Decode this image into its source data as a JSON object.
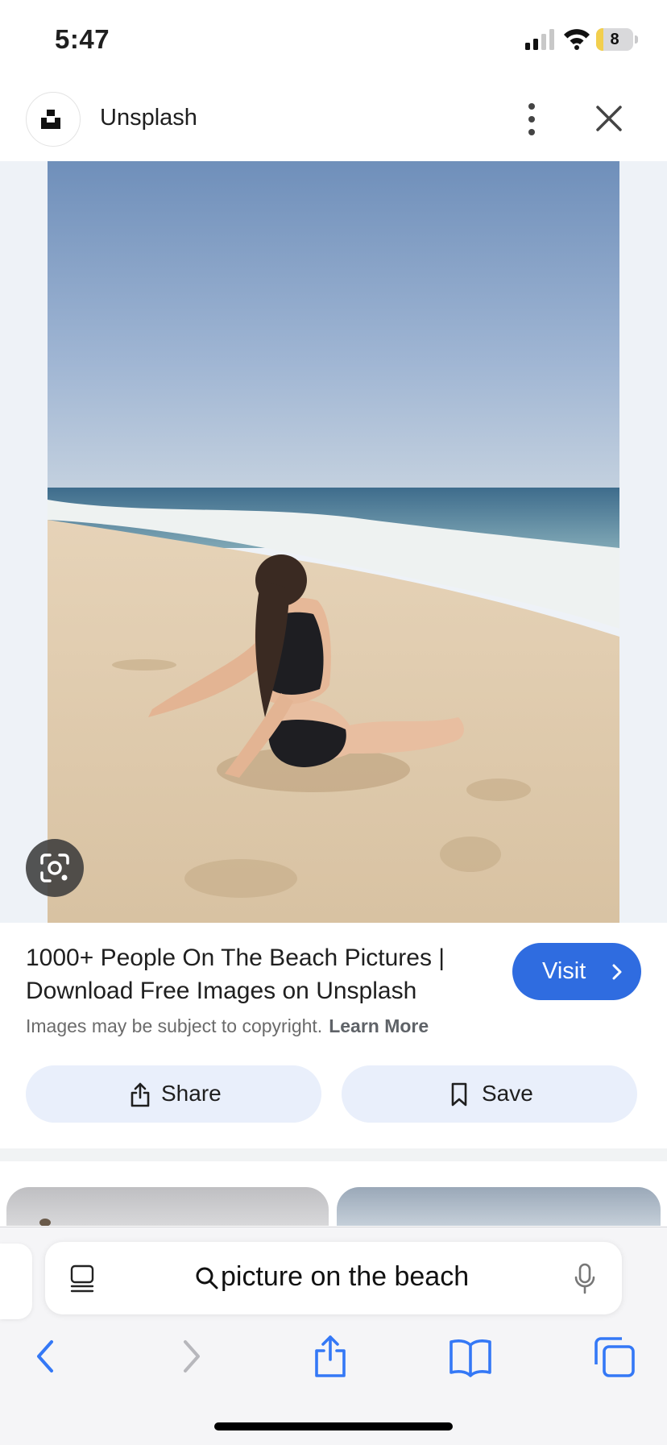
{
  "status_bar": {
    "time": "5:47",
    "battery_level": "8",
    "battery_fraction": 0.08
  },
  "site": {
    "name": "Unsplash"
  },
  "result": {
    "title": "1000+ People On The Beach Pictures | Download Free Images on Unsplash",
    "copyright_text": "Images may be subject to copyright.",
    "learn_more": "Learn More",
    "visit_label": "Visit"
  },
  "actions": {
    "share_label": "Share",
    "save_label": "Save"
  },
  "address_bar": {
    "query": "picture on the beach"
  },
  "icons": {
    "site_logo": "unsplash-logo-icon",
    "more": "more-vertical-icon",
    "close": "close-icon",
    "lens": "google-lens-icon",
    "share": "share-icon",
    "save": "bookmark-icon",
    "reader": "reader-view-icon",
    "search": "search-icon",
    "mic": "microphone-icon",
    "back": "back-chevron-icon",
    "forward": "forward-chevron-icon",
    "safari_share": "share-icon",
    "bookmarks": "book-icon",
    "tabs": "tabs-icon"
  },
  "colors": {
    "accent": "#2f6ce0",
    "safari_blue": "#3478f6",
    "chip_bg": "#e9effb"
  }
}
